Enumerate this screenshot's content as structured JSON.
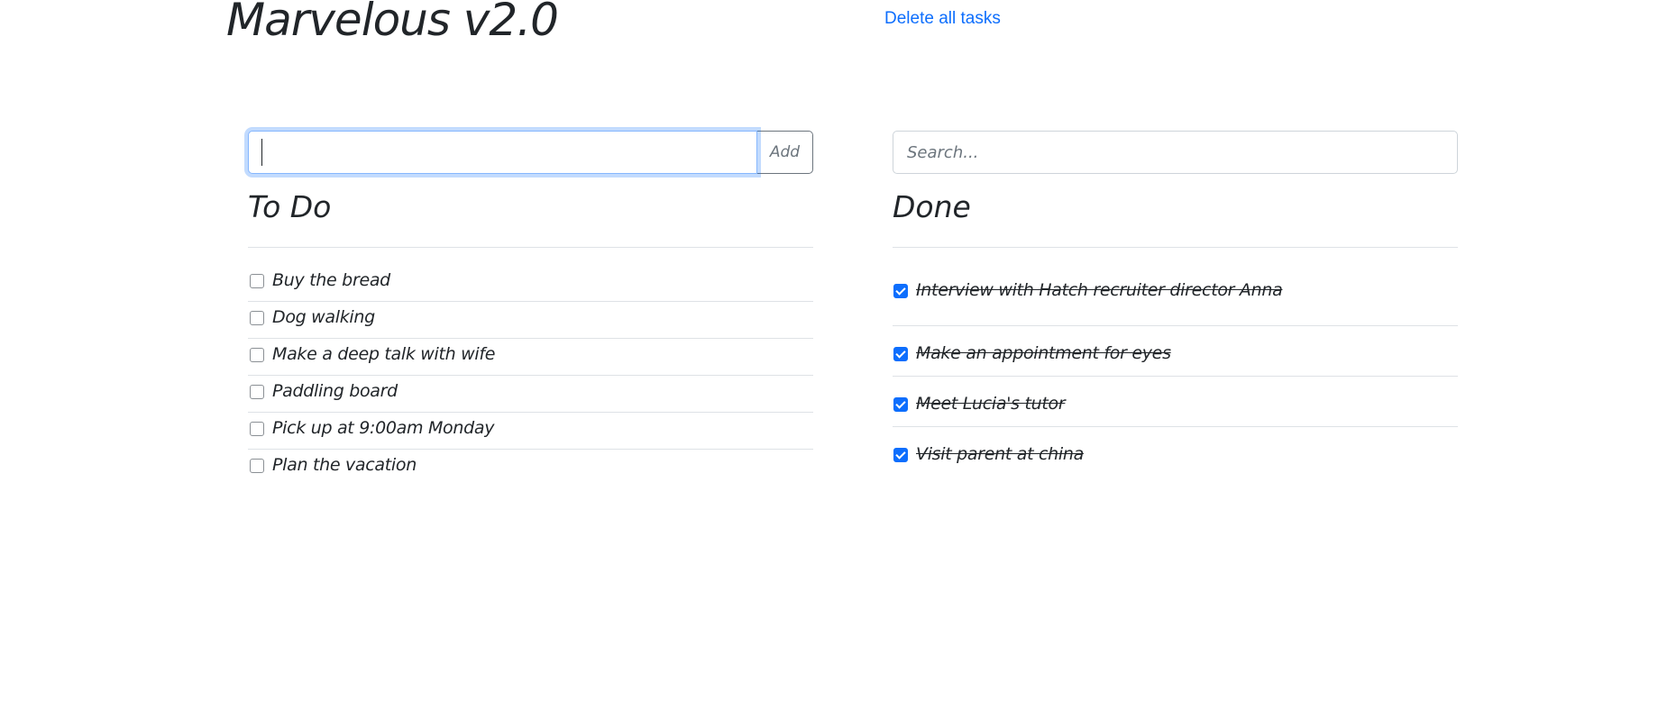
{
  "header": {
    "app_title": "Marvelous v2.0",
    "delete_all_label": "Delete all tasks"
  },
  "todo": {
    "input_value": "",
    "add_label": "Add",
    "heading": "To Do",
    "items": [
      {
        "label": "Buy the bread",
        "checked": false
      },
      {
        "label": "Dog walking",
        "checked": false
      },
      {
        "label": "Make a deep talk with wife",
        "checked": false
      },
      {
        "label": "Paddling board",
        "checked": false
      },
      {
        "label": "Pick up at 9:00am Monday",
        "checked": false
      },
      {
        "label": "Plan the vacation",
        "checked": false
      }
    ]
  },
  "done": {
    "search_placeholder": "Search...",
    "heading": "Done",
    "items": [
      {
        "label": "Interview with Hatch recruiter director Anna",
        "checked": true
      },
      {
        "label": "Make an appointment for eyes",
        "checked": true
      },
      {
        "label": "Meet Lucia's tutor",
        "checked": true
      },
      {
        "label": "Visit parent at china",
        "checked": true
      }
    ]
  },
  "colors": {
    "link": "#0d6efd",
    "checkbox_checked": "#0d6efd",
    "divider": "#dee2e6"
  }
}
